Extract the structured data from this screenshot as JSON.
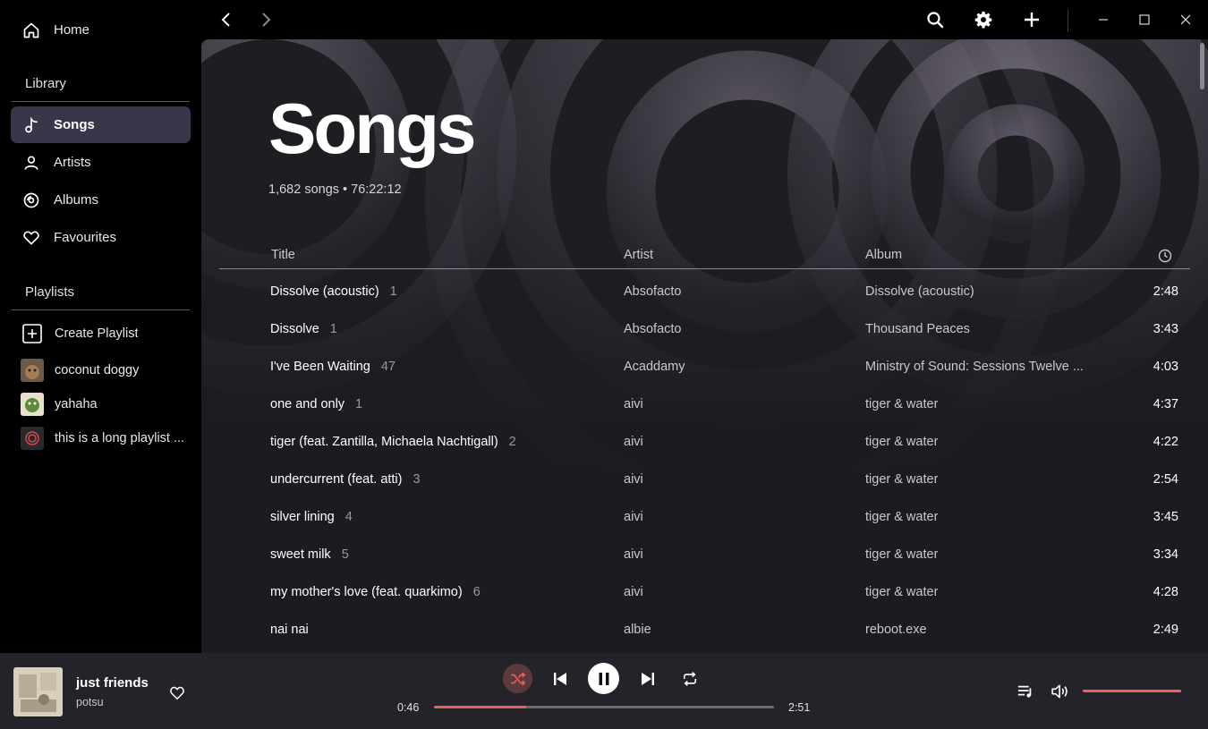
{
  "sidebar": {
    "home_label": "Home",
    "library_label": "Library",
    "library_items": [
      {
        "label": "Songs",
        "icon": "music-note-icon",
        "active": true
      },
      {
        "label": "Artists",
        "icon": "person-icon"
      },
      {
        "label": "Albums",
        "icon": "disc-icon"
      },
      {
        "label": "Favourites",
        "icon": "heart-icon"
      }
    ],
    "playlists_label": "Playlists",
    "create_playlist_label": "Create Playlist",
    "playlists": [
      {
        "label": "coconut doggy"
      },
      {
        "label": "yahaha"
      },
      {
        "label": "this is a long playlist ..."
      }
    ]
  },
  "page": {
    "title": "Songs",
    "subtitle": "1,682 songs • 76:22:12"
  },
  "table": {
    "headers": {
      "title": "Title",
      "artist": "Artist",
      "album": "Album",
      "duration_icon": "clock-icon"
    },
    "rows": [
      {
        "title": "Dissolve (acoustic)",
        "track": "1",
        "artist": "Absofacto",
        "album": "Dissolve (acoustic)",
        "duration": "2:48"
      },
      {
        "title": "Dissolve",
        "track": "1",
        "artist": "Absofacto",
        "album": "Thousand Peaces",
        "duration": "3:43"
      },
      {
        "title": "I've Been Waiting",
        "track": "47",
        "artist": "Acaddamy",
        "album": "Ministry of Sound: Sessions Twelve ...",
        "duration": "4:03"
      },
      {
        "title": "one and only",
        "track": "1",
        "artist": "aivi",
        "album": "tiger & water",
        "duration": "4:37"
      },
      {
        "title": "tiger (feat. Zantilla, Michaela Nachtigall)",
        "track": "2",
        "artist": "aivi",
        "album": "tiger & water",
        "duration": "4:22"
      },
      {
        "title": "undercurrent (feat. atti)",
        "track": "3",
        "artist": "aivi",
        "album": "tiger & water",
        "duration": "2:54"
      },
      {
        "title": "silver lining",
        "track": "4",
        "artist": "aivi",
        "album": "tiger & water",
        "duration": "3:45"
      },
      {
        "title": "sweet milk",
        "track": "5",
        "artist": "aivi",
        "album": "tiger & water",
        "duration": "3:34"
      },
      {
        "title": "my mother's love (feat. quarkimo)",
        "track": "6",
        "artist": "aivi",
        "album": "tiger & water",
        "duration": "4:28"
      },
      {
        "title": "nai nai",
        "track": "",
        "artist": "albie",
        "album": "reboot.exe",
        "duration": "2:49"
      }
    ]
  },
  "player": {
    "track_title": "just friends",
    "track_artist": "potsu",
    "time_current": "0:46",
    "time_total": "2:51",
    "progress_fraction": 0.27,
    "volume_fraction": 1.0,
    "shuffle_active": true
  },
  "colors": {
    "accent": "#e8625e",
    "active_nav": "#3a3548",
    "player_bg": "#25232a",
    "main_bg": "#1c1b1f"
  }
}
